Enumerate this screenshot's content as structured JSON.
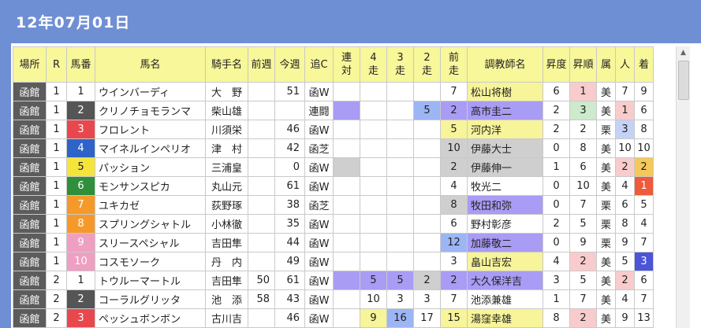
{
  "title": "12年07月01日",
  "headers": [
    "場所",
    "R",
    "馬番",
    "馬名",
    "騎手名",
    "前週",
    "今週",
    "追C",
    "連\n対",
    "4\n走",
    "3\n走",
    "2\n走",
    "前\n走",
    "調教師名",
    "昇度",
    "昇順",
    "属",
    "人",
    "着"
  ],
  "rows": [
    {
      "place": "函館",
      "r": "1",
      "num": "1",
      "numClass": "b1",
      "horse": "ウインバーディ",
      "jockey": "大　野",
      "prev": "",
      "now": "51",
      "oic": "函W",
      "ren": "",
      "s4": "",
      "s3": "",
      "s2": "",
      "s1": "7",
      "trainer": "松山将樹",
      "shodo": "6",
      "shojun": "1",
      "zoku": "美",
      "nin": "7",
      "chaku": "9",
      "cls": {
        "trainer": "hl-yellow",
        "shojun": "hl-pink"
      }
    },
    {
      "place": "函館",
      "r": "1",
      "num": "2",
      "numClass": "b2",
      "horse": "クリノチョモランマ",
      "jockey": "柴山雄",
      "prev": "",
      "now": "",
      "oic": "連闘",
      "ren": "",
      "s4": "",
      "s3": "",
      "s2": "5",
      "s1": "2",
      "trainer": "高市圭二",
      "shodo": "2",
      "shojun": "3",
      "zoku": "美",
      "nin": "1",
      "chaku": "6",
      "cls": {
        "ren": "hl-purple",
        "s2": "hl-blue",
        "s1": "hl-purple",
        "trainer": "hl-purple",
        "shojun": "hl-green",
        "nin": "hl-pink"
      }
    },
    {
      "place": "函館",
      "r": "1",
      "num": "3",
      "numClass": "b3",
      "horse": "フロレント",
      "jockey": "川須栄",
      "prev": "",
      "now": "46",
      "oic": "函W",
      "ren": "",
      "s4": "",
      "s3": "",
      "s2": "",
      "s1": "5",
      "trainer": "河内洋",
      "shodo": "2",
      "shojun": "2",
      "zoku": "栗",
      "nin": "3",
      "chaku": "8",
      "cls": {
        "s1": "hl-yellow",
        "trainer": "hl-yellow",
        "nin": "hl-lblue"
      }
    },
    {
      "place": "函館",
      "r": "1",
      "num": "4",
      "numClass": "b4",
      "horse": "マイネルインペリオ",
      "jockey": "津　村",
      "prev": "",
      "now": "42",
      "oic": "函芝",
      "ren": "",
      "s4": "",
      "s3": "",
      "s2": "",
      "s1": "10",
      "trainer": "伊藤大士",
      "shodo": "0",
      "shojun": "8",
      "zoku": "美",
      "nin": "10",
      "chaku": "10",
      "cls": {
        "s1": "hl-gray",
        "trainer": "hl-gray"
      }
    },
    {
      "place": "函館",
      "r": "1",
      "num": "5",
      "numClass": "b5",
      "horse": "パッション",
      "jockey": "三浦皇",
      "prev": "",
      "now": "0",
      "oic": "函W",
      "ren": "",
      "s4": "",
      "s3": "",
      "s2": "",
      "s1": "2",
      "trainer": "伊藤伸一",
      "shodo": "1",
      "shojun": "6",
      "zoku": "美",
      "nin": "2",
      "chaku": "2",
      "cls": {
        "ren": "hl-gray",
        "s1": "hl-gray",
        "trainer": "hl-gray",
        "nin": "hl-pink",
        "chaku": "hl-orange"
      }
    },
    {
      "place": "函館",
      "r": "1",
      "num": "6",
      "numClass": "b6",
      "horse": "モンサンスピカ",
      "jockey": "丸山元",
      "prev": "",
      "now": "61",
      "oic": "函W",
      "ren": "",
      "s4": "",
      "s3": "",
      "s2": "",
      "s1": "4",
      "trainer": "牧光二",
      "shodo": "0",
      "shojun": "10",
      "zoku": "美",
      "nin": "4",
      "chaku": "1",
      "cls": {
        "chaku": "hl-red"
      }
    },
    {
      "place": "函館",
      "r": "1",
      "num": "7",
      "numClass": "b7",
      "horse": "ユキカゼ",
      "jockey": "荻野琢",
      "prev": "",
      "now": "38",
      "oic": "函芝",
      "ren": "",
      "s4": "",
      "s3": "",
      "s2": "",
      "s1": "8",
      "trainer": "牧田和弥",
      "shodo": "0",
      "shojun": "7",
      "zoku": "栗",
      "nin": "6",
      "chaku": "5",
      "cls": {
        "s1": "hl-gray",
        "trainer": "hl-purple"
      }
    },
    {
      "place": "函館",
      "r": "1",
      "num": "8",
      "numClass": "b7",
      "horse": "スプリングシャトル",
      "jockey": "小林徹",
      "prev": "",
      "now": "35",
      "oic": "函W",
      "ren": "",
      "s4": "",
      "s3": "",
      "s2": "",
      "s1": "6",
      "trainer": "野村彰彦",
      "shodo": "2",
      "shojun": "5",
      "zoku": "栗",
      "nin": "8",
      "chaku": "4",
      "cls": {}
    },
    {
      "place": "函館",
      "r": "1",
      "num": "9",
      "numClass": "b8",
      "horse": "スリースペシャル",
      "jockey": "吉田隼",
      "prev": "",
      "now": "44",
      "oic": "函W",
      "ren": "",
      "s4": "",
      "s3": "",
      "s2": "",
      "s1": "12",
      "trainer": "加藤敬二",
      "shodo": "0",
      "shojun": "9",
      "zoku": "栗",
      "nin": "9",
      "chaku": "7",
      "cls": {
        "s1": "hl-blue",
        "trainer": "hl-purple"
      }
    },
    {
      "place": "函館",
      "r": "1",
      "num": "10",
      "numClass": "b8",
      "horse": "コスモソーク",
      "jockey": "丹　内",
      "prev": "",
      "now": "49",
      "oic": "函W",
      "ren": "",
      "s4": "",
      "s3": "",
      "s2": "",
      "s1": "3",
      "trainer": "畠山吉宏",
      "shodo": "4",
      "shojun": "2",
      "zoku": "美",
      "nin": "5",
      "chaku": "3",
      "cls": {
        "trainer": "hl-yellow",
        "shojun": "hl-pink",
        "chaku": "hl-navy"
      }
    },
    {
      "place": "函館",
      "r": "2",
      "num": "1",
      "numClass": "b1",
      "horse": "トウルーマートル",
      "jockey": "吉田隼",
      "prev": "50",
      "now": "61",
      "oic": "函W",
      "ren": "",
      "s4": "5",
      "s3": "5",
      "s2": "2",
      "s1": "2",
      "trainer": "大久保洋吉",
      "shodo": "3",
      "shojun": "5",
      "zoku": "美",
      "nin": "2",
      "chaku": "6",
      "cls": {
        "ren": "hl-purple",
        "s4": "hl-purple",
        "s3": "hl-purple",
        "s2": "hl-gray",
        "s1": "hl-purple",
        "trainer": "hl-purple",
        "nin": "hl-pink"
      }
    },
    {
      "place": "函館",
      "r": "2",
      "num": "2",
      "numClass": "b2",
      "horse": "コーラルグリッタ",
      "jockey": "池　添",
      "prev": "58",
      "now": "43",
      "oic": "函W",
      "ren": "",
      "s4": "10",
      "s3": "3",
      "s2": "3",
      "s1": "7",
      "trainer": "池添兼雄",
      "shodo": "1",
      "shojun": "7",
      "zoku": "美",
      "nin": "4",
      "chaku": "7",
      "cls": {}
    },
    {
      "place": "函館",
      "r": "2",
      "num": "3",
      "numClass": "b3",
      "horse": "ペッシュボンボン",
      "jockey": "古川吉",
      "prev": "",
      "now": "46",
      "oic": "函W",
      "ren": "",
      "s4": "9",
      "s3": "16",
      "s2": "17",
      "s1": "15",
      "trainer": "湯窪幸雄",
      "shodo": "8",
      "shojun": "2",
      "zoku": "美",
      "nin": "9",
      "chaku": "13",
      "cls": {
        "s4": "hl-yellow",
        "s3": "hl-blue",
        "s1": "hl-yellow",
        "trainer": "hl-yellow",
        "shojun": "hl-pink"
      }
    }
  ],
  "scrollbar": {
    "up_icon": "triangle-up"
  }
}
